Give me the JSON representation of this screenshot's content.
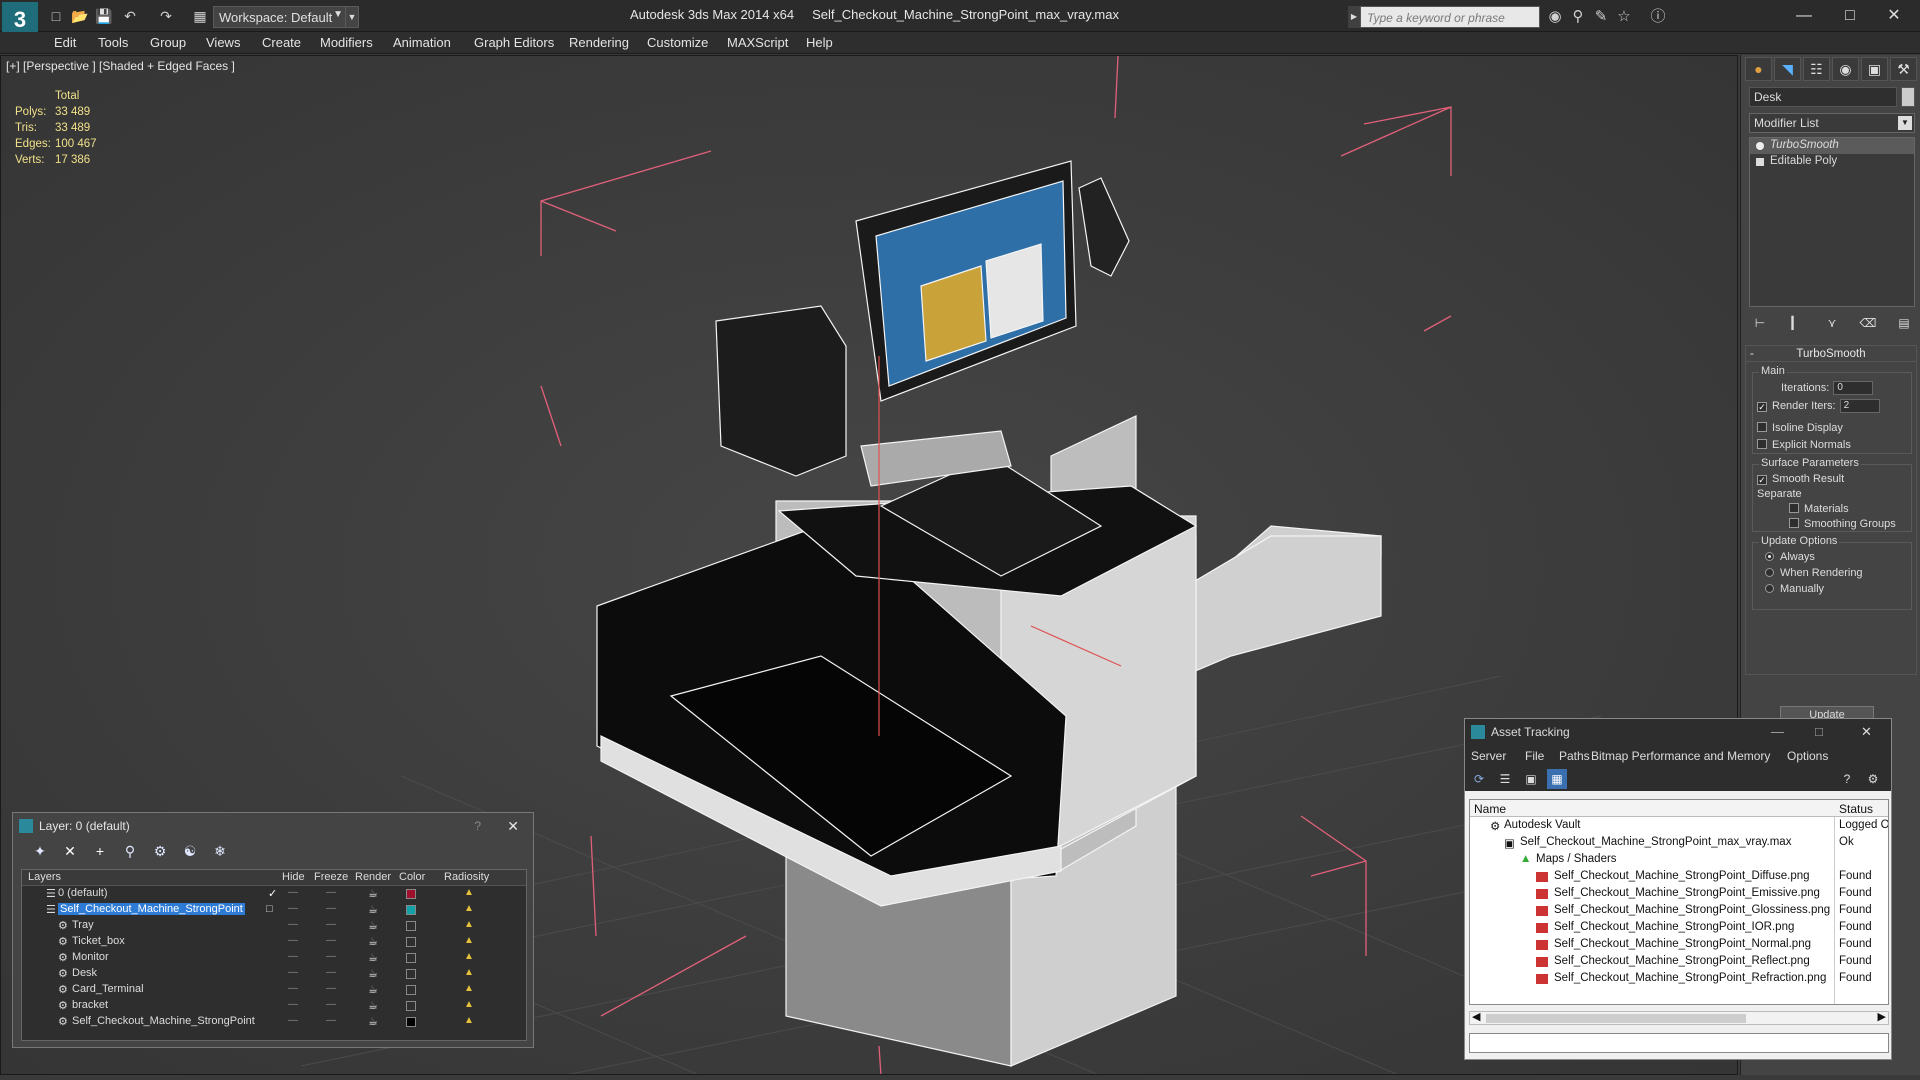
{
  "app": {
    "title": "Autodesk 3ds Max 2014 x64",
    "file": "Self_Checkout_Machine_StrongPoint_max_vray.max",
    "workspace": "Workspace: Default",
    "search_placeholder": "Type a keyword or phrase"
  },
  "menu": [
    "Edit",
    "Tools",
    "Group",
    "Views",
    "Create",
    "Modifiers",
    "Animation",
    "Graph Editors",
    "Rendering",
    "Customize",
    "MAXScript",
    "Help"
  ],
  "viewport": {
    "label": "[+] [Perspective ] [Shaded + Edged Faces ]",
    "stats_header": "Total",
    "stats": [
      {
        "k": "Polys:",
        "v": "33 489"
      },
      {
        "k": "Tris:",
        "v": "33 489"
      },
      {
        "k": "Edges:",
        "v": "100 467"
      },
      {
        "k": "Verts:",
        "v": "17 386"
      }
    ]
  },
  "command_panel": {
    "object_name": "Desk",
    "modifier_list": "Modifier List",
    "stack": [
      "TurboSmooth",
      "Editable Poly"
    ],
    "rollout_title": "TurboSmooth",
    "main_label": "Main",
    "iterations_label": "Iterations:",
    "iterations_value": "0",
    "render_iters_label": "Render Iters:",
    "render_iters_value": "2",
    "isoline": "Isoline Display",
    "explicit_normals": "Explicit Normals",
    "surface_params": "Surface Parameters",
    "smooth_result": "Smooth Result",
    "separate": "Separate",
    "materials": "Materials",
    "smoothing_groups": "Smoothing Groups",
    "update_options": "Update Options",
    "always": "Always",
    "when_rendering": "When Rendering",
    "manually": "Manually",
    "update_btn": "Update"
  },
  "layer_window": {
    "title": "Layer: 0 (default)",
    "help": "?",
    "columns": [
      "Layers",
      "Hide",
      "Freeze",
      "Render",
      "Color",
      "Radiosity"
    ],
    "rows": [
      {
        "name": "0 (default)",
        "color": "#a0102a"
      },
      {
        "name": "Self_Checkout_Machine_StrongPoint",
        "color": "#14a0a8"
      },
      {
        "name": "Tray",
        "color": "#3a3a3a"
      },
      {
        "name": "Ticket_box",
        "color": "#3a3a3a"
      },
      {
        "name": "Monitor",
        "color": "#3a3a3a"
      },
      {
        "name": "Desk",
        "color": "#3a3a3a"
      },
      {
        "name": "Card_Terminal",
        "color": "#3a3a3a"
      },
      {
        "name": "bracket",
        "color": "#3a3a3a"
      },
      {
        "name": "Self_Checkout_Machine_StrongPoint",
        "color": "#000000"
      }
    ]
  },
  "asset_window": {
    "title": "Asset Tracking",
    "menu": [
      "Server",
      "File",
      "Paths",
      "Bitmap Performance and Memory",
      "Options"
    ],
    "col_name": "Name",
    "col_status": "Status",
    "rows": [
      {
        "name": "Autodesk Vault",
        "status": "Logged O"
      },
      {
        "name": "Self_Checkout_Machine_StrongPoint_max_vray.max",
        "status": "Ok"
      },
      {
        "name": "Maps / Shaders",
        "status": ""
      },
      {
        "name": "Self_Checkout_Machine_StrongPoint_Diffuse.png",
        "status": "Found"
      },
      {
        "name": "Self_Checkout_Machine_StrongPoint_Emissive.png",
        "status": "Found"
      },
      {
        "name": "Self_Checkout_Machine_StrongPoint_Glossiness.png",
        "status": "Found"
      },
      {
        "name": "Self_Checkout_Machine_StrongPoint_IOR.png",
        "status": "Found"
      },
      {
        "name": "Self_Checkout_Machine_StrongPoint_Normal.png",
        "status": "Found"
      },
      {
        "name": "Self_Checkout_Machine_StrongPoint_Reflect.png",
        "status": "Found"
      },
      {
        "name": "Self_Checkout_Machine_StrongPoint_Refraction.png",
        "status": "Found"
      }
    ]
  }
}
